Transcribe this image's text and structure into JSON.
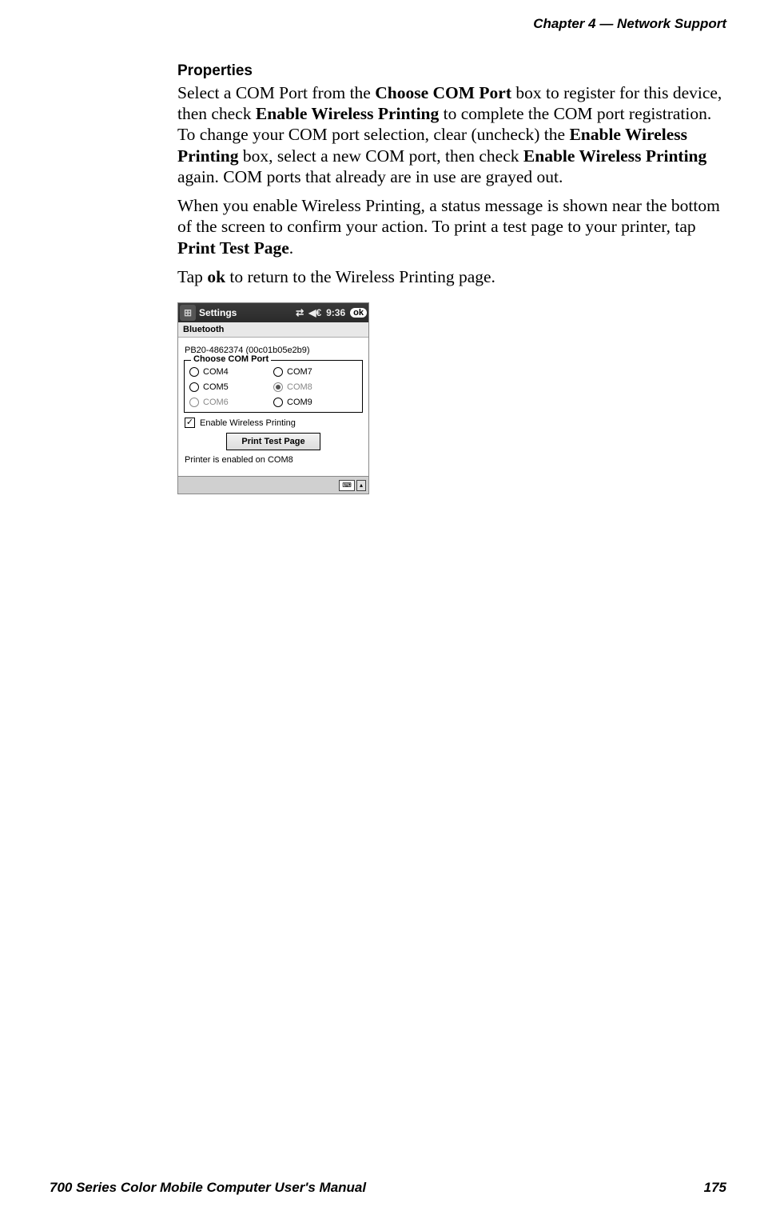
{
  "header": {
    "text": "Chapter  4  —  Network Support"
  },
  "section": {
    "title": "Properties",
    "p1_a": "Select a COM Port from the ",
    "p1_b1": "Choose COM Port",
    "p1_c": " box to register for this device, then check ",
    "p1_b2": "Enable Wireless Printing",
    "p1_d": " to complete the COM port registration. To change your COM port selection, clear (uncheck) the ",
    "p1_b3": "Enable Wireless Printing",
    "p1_e": " box, select a new COM port, then check ",
    "p1_b4": "Enable Wireless Printing",
    "p1_f": " again. COM ports that already are in use are grayed out.",
    "p2_a": "When you enable Wireless Printing, a status message is shown near the bottom of the screen to confirm your action. To print a test page to your printer, tap ",
    "p2_b1": "Print Test Page",
    "p2_c": ".",
    "p3_a": "Tap ",
    "p3_b1": "ok",
    "p3_c": " to return to the Wireless Printing page."
  },
  "screenshot": {
    "titlebar": {
      "label": "Settings",
      "time": "9:36",
      "ok": "ok"
    },
    "bluetooth_label": "Bluetooth",
    "device": "PB20-4862374 (00c01b05e2b9)",
    "fieldset_legend": "Choose COM Port",
    "radios": {
      "com4": "COM4",
      "com5": "COM5",
      "com6": "COM6",
      "com7": "COM7",
      "com8": "COM8",
      "com9": "COM9"
    },
    "checkbox_label": "Enable Wireless Printing",
    "print_button": "Print Test Page",
    "status": "Printer is enabled on COM8"
  },
  "footer": {
    "left": "700 Series Color Mobile Computer User's Manual",
    "right": "175"
  }
}
